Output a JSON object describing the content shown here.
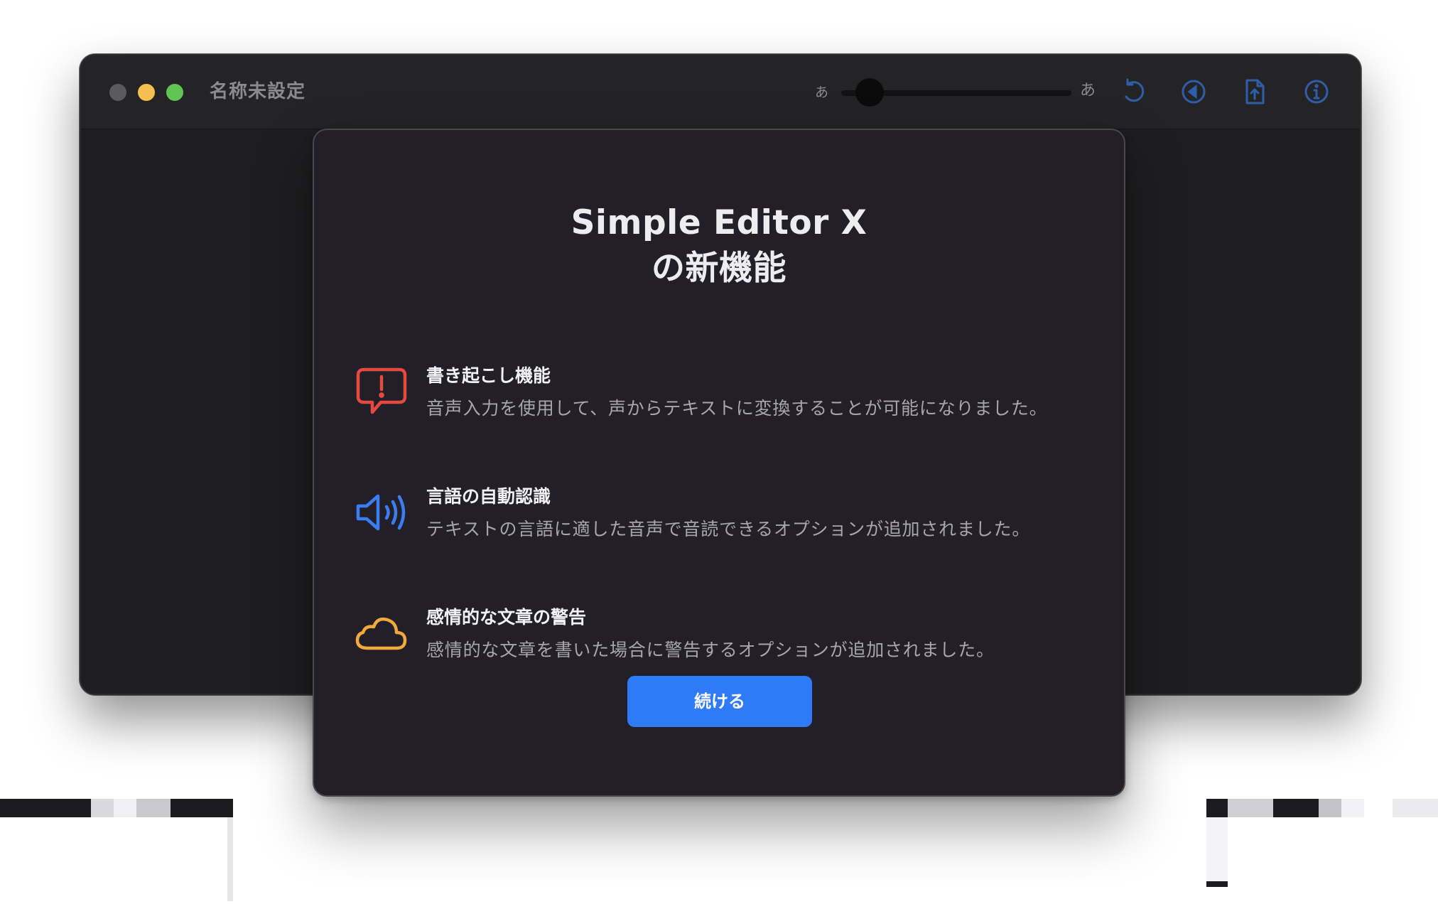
{
  "window": {
    "title": "名称未設定",
    "font_size_small_label": "あ",
    "font_size_large_label": "あ",
    "toolbar_icons": [
      "undo-icon",
      "play-back-icon",
      "share-document-icon",
      "info-icon"
    ],
    "accent_color": "#2f5ea8"
  },
  "sheet": {
    "title_line1": "Simple Editor X",
    "title_line2": "の新機能",
    "features": [
      {
        "icon": "alert-bubble-icon",
        "icon_color": "#e5493f",
        "title": "書き起こし機能",
        "description": "音声入力を使用して、声からテキストに変換することが可能になりました。"
      },
      {
        "icon": "speaker-icon",
        "icon_color": "#3a7ef2",
        "title": "言語の自動認識",
        "description": "テキストの言語に適した音声で音読できるオプションが追加されました。"
      },
      {
        "icon": "cloud-icon",
        "icon_color": "#f2a93b",
        "title": "感情的な文章の警告",
        "description": "感情的な文章を書いた場合に警告するオプションが追加されました。"
      }
    ],
    "continue_label": "続ける",
    "continue_color": "#2f7af7"
  }
}
